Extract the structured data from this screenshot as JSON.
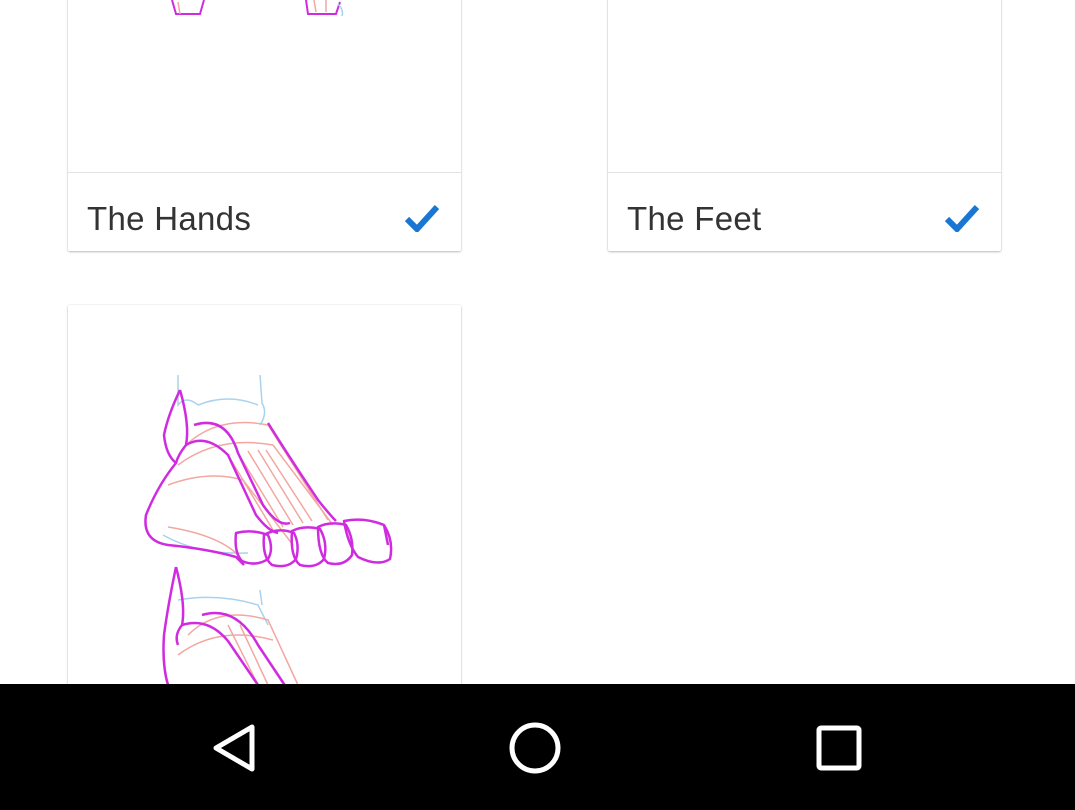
{
  "cards": [
    {
      "title": "The Hands",
      "completed": true,
      "thumbnail": "hands-sketch"
    },
    {
      "title": "The Feet",
      "completed": true,
      "thumbnail": "feet-sketch"
    },
    {
      "title": "",
      "completed": false,
      "thumbnail": "feet-anatomy-sketch"
    }
  ],
  "colors": {
    "check": "#1976D2",
    "sketch_primary": "#D02BE0",
    "sketch_secondary": "#F2A7A0",
    "sketch_tertiary": "#A9D3EC",
    "navbar": "#000000",
    "nav_icon": "#ffffff"
  },
  "navbar": {
    "buttons": [
      "back-icon",
      "home-icon",
      "recents-icon"
    ]
  }
}
